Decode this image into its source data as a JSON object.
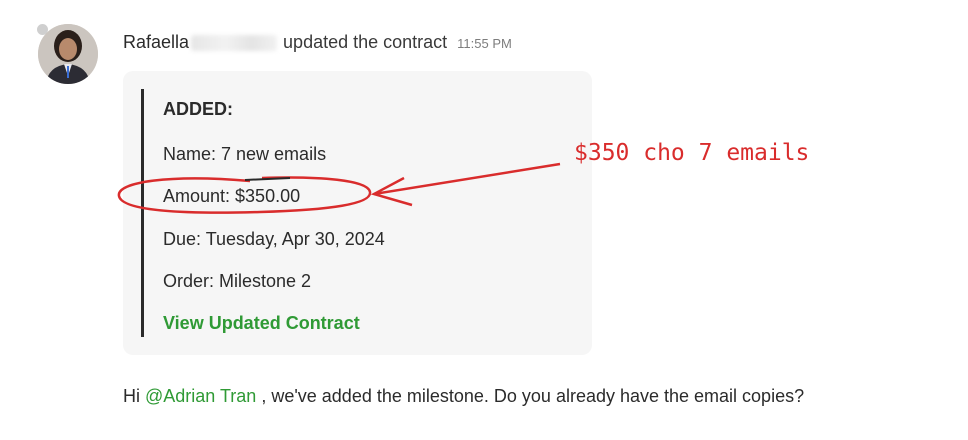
{
  "activity": {
    "author_first_name": "Rafaella",
    "action": "updated the contract",
    "timestamp": "11:55 PM"
  },
  "contract_card": {
    "heading": "ADDED:",
    "name_line": "Name: 7 new emails",
    "amount_line": "Amount: $350.00",
    "due_line": "Due: Tuesday, Apr 30, 2024",
    "order_line": "Order: Milestone 2",
    "link_label": "View Updated Contract"
  },
  "annotation": {
    "text": "$350 cho 7 emails",
    "color": "#d92c2c"
  },
  "message": {
    "greeting": "Hi ",
    "mention": "@Adrian Tran",
    "body": " , we've added the milestone. Do you already have the email copies?"
  },
  "colors": {
    "link_green": "#2f9a35",
    "card_background": "#f6f6f6",
    "annotation_red": "#d92c2c"
  }
}
